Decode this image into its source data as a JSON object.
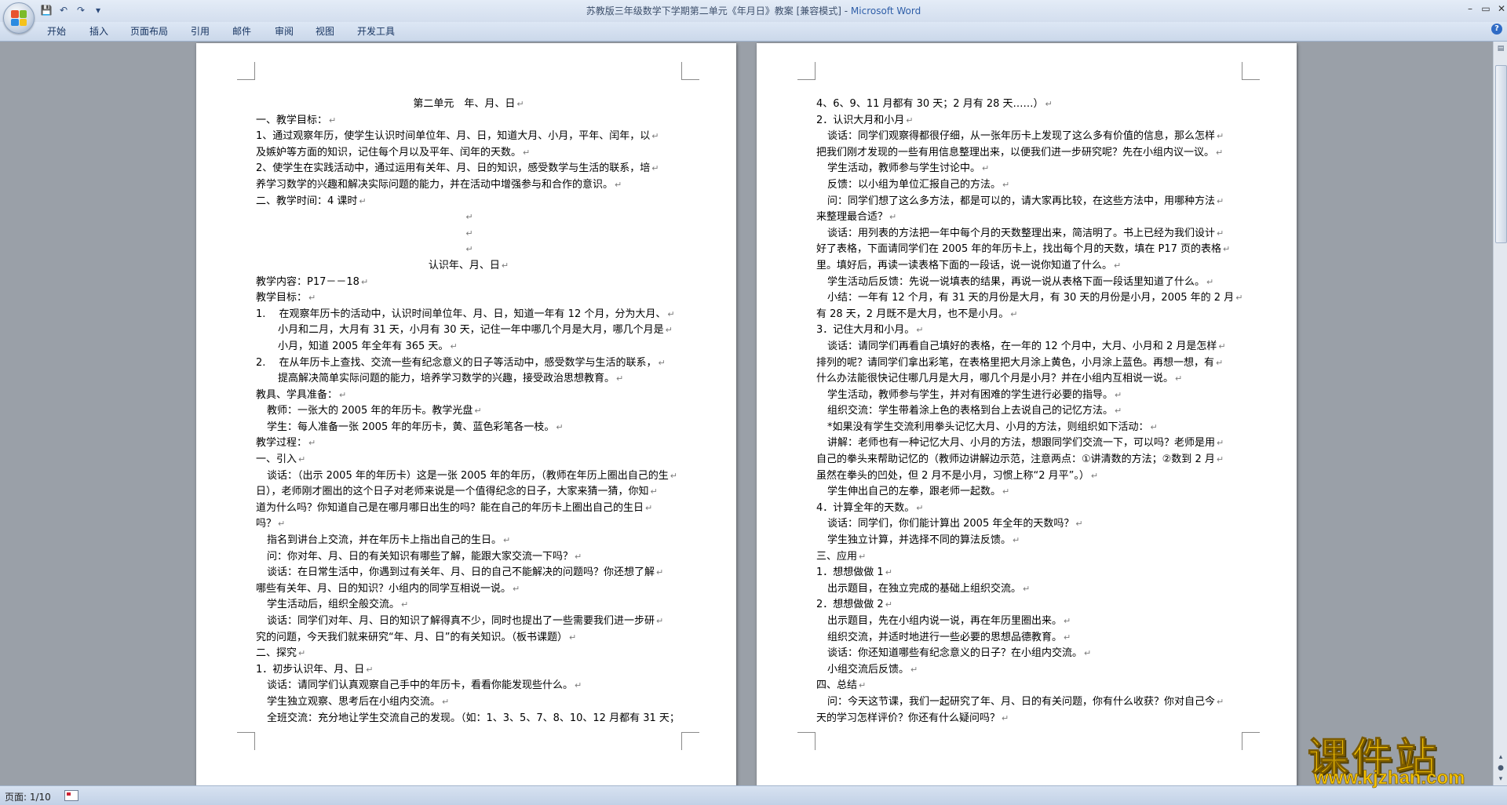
{
  "window": {
    "title": "苏教版三年级数学下学期第二单元《年月日》教案 [兼容模式] - ",
    "app_name": "Microsoft Word",
    "minimize": "–",
    "maximize": "▭",
    "close": "✕"
  },
  "qat": {
    "save": "💾",
    "undo": "↶",
    "redo": "↷",
    "dropdown": "▾"
  },
  "ribbon_tabs": [
    "开始",
    "插入",
    "页面布局",
    "引用",
    "邮件",
    "审阅",
    "视图",
    "开发工具"
  ],
  "help": "?",
  "pages": {
    "left": [
      {
        "t": "第二单元　年、月、日",
        "c": "c"
      },
      {
        "t": "一、教学目标："
      },
      {
        "t": "1、通过观察年历，使学生认识时间单位年、月、日，知道大月、小月，平年、闰年，以"
      },
      {
        "t": "及嫉妒等方面的知识，记住每个月以及平年、闰年的天数。"
      },
      {
        "t": "2、使学生在实践活动中，通过运用有关年、月、日的知识，感受数学与生活的联系，培"
      },
      {
        "t": "养学习数学的兴趣和解决实际问题的能力，并在活动中增强参与和合作的意识。"
      },
      {
        "t": "二、教学时间：4 课时"
      },
      {
        "t": "",
        "c": "c"
      },
      {
        "t": "",
        "c": "c"
      },
      {
        "t": "",
        "c": "c"
      },
      {
        "t": "认识年、月、日",
        "c": "c"
      },
      {
        "t": "教学内容：P17－－18"
      },
      {
        "t": "教学目标："
      },
      {
        "t": "1.　 在观察年历卡的活动中，认识时间单位年、月、日，知道一年有 12 个月，分为大月、"
      },
      {
        "t": "小月和二月，大月有 31 天，小月有 30 天，记住一年中哪几个月是大月，哪几个月是",
        "c": "hang2"
      },
      {
        "t": "小月，知道 2005 年全年有 365 天。",
        "c": "hang2"
      },
      {
        "t": "2.　 在从年历卡上查找、交流一些有纪念意义的日子等活动中，感受数学与生活的联系，"
      },
      {
        "t": "提高解决简单实际问题的能力，培养学习数学的兴趣，接受政治思想教育。",
        "c": "hang2"
      },
      {
        "t": "教具、学具准备："
      },
      {
        "t": "教师：一张大的 2005 年的年历卡。教学光盘",
        "c": "i2"
      },
      {
        "t": "学生：每人准备一张 2005 年的年历卡，黄、蓝色彩笔各一枝。",
        "c": "i2"
      },
      {
        "t": "教学过程："
      },
      {
        "t": "一、引入"
      },
      {
        "t": "谈话：（出示 2005 年的年历卡）这是一张 2005 年的年历，（教师在年历上圈出自己的生",
        "c": "i2"
      },
      {
        "t": "日），老师刚才圈出的这个日子对老师来说是一个值得纪念的日子，大家来猜一猜，你知"
      },
      {
        "t": "道为什么吗？你知道自己是在哪月哪日出生的吗？能在自己的年历卡上圈出自己的生日"
      },
      {
        "t": "吗？"
      },
      {
        "t": "指名到讲台上交流，并在年历卡上指出自己的生日。",
        "c": "i2"
      },
      {
        "t": "问：你对年、月、日的有关知识有哪些了解，能跟大家交流一下吗？",
        "c": "i2"
      },
      {
        "t": "谈话：在日常生活中，你遇到过有关年、月、日的自己不能解决的问题吗？你还想了解",
        "c": "i2"
      },
      {
        "t": "哪些有关年、月、日的知识？小组内的同学互相说一说。"
      },
      {
        "t": "学生活动后，组织全般交流。",
        "c": "i2"
      },
      {
        "t": "谈话：同学们对年、月、日的知识了解得真不少，同时也提出了一些需要我们进一步研",
        "c": "i2"
      },
      {
        "t": "究的问题，今天我们就来研究“年、月、日”的有关知识。（板书课题）"
      },
      {
        "t": "二、探究"
      },
      {
        "t": "1．初步认识年、月、日"
      },
      {
        "t": "谈话：请同学们认真观察自己手中的年历卡，看看你能发现些什么。",
        "c": "i2"
      },
      {
        "t": "学生独立观察、思考后在小组内交流。",
        "c": "i2"
      },
      {
        "t": "全班交流：充分地让学生交流自己的发现。（如：1、3、5、7、8、10、12 月都有 31 天；",
        "c": "i2"
      }
    ],
    "right": [
      {
        "t": "4、6、9、11 月都有 30 天；2 月有 28 天……）"
      },
      {
        "t": "2．认识大月和小月"
      },
      {
        "t": "谈话：同学们观察得都很仔细，从一张年历卡上发现了这么多有价值的信息，那么怎样",
        "c": "i2"
      },
      {
        "t": "把我们刚才发现的一些有用信息整理出来，以便我们进一步研究呢？先在小组内议一议。"
      },
      {
        "t": "学生活动，教师参与学生讨论中。",
        "c": "i2"
      },
      {
        "t": "反馈：以小组为单位汇报自己的方法。",
        "c": "i2"
      },
      {
        "t": "问：同学们想了这么多方法，都是可以的，请大家再比较，在这些方法中，用哪种方法",
        "c": "i2"
      },
      {
        "t": "来整理最合适？"
      },
      {
        "t": "谈话：用列表的方法把一年中每个月的天数整理出来，简洁明了。书上已经为我们设计",
        "c": "i2"
      },
      {
        "t": "好了表格，下面请同学们在 2005 年的年历卡上，找出每个月的天数，填在 P17 页的表格"
      },
      {
        "t": "里。填好后，再读一读表格下面的一段话，说一说你知道了什么。"
      },
      {
        "t": "学生活动后反馈：先说一说填表的结果，再说一说从表格下面一段话里知道了什么。",
        "c": "i2"
      },
      {
        "t": "小结：一年有 12 个月，有 31 天的月份是大月，有 30 天的月份是小月，2005 年的 2 月",
        "c": "i2"
      },
      {
        "t": "有 28 天，2 月既不是大月，也不是小月。"
      },
      {
        "t": "3．记住大月和小月。"
      },
      {
        "t": "谈话：请同学们再看自己填好的表格，在一年的 12 个月中，大月、小月和 2 月是怎样",
        "c": "i2"
      },
      {
        "t": "排列的呢？请同学们拿出彩笔，在表格里把大月涂上黄色，小月涂上蓝色。再想一想，有"
      },
      {
        "t": "什么办法能很快记住哪几月是大月，哪几个月是小月？并在小组内互相说一说。"
      },
      {
        "t": "学生活动，教师参与学生，并对有困难的学生进行必要的指导。",
        "c": "i2"
      },
      {
        "t": "组织交流：学生带着涂上色的表格到台上去说自己的记忆方法。",
        "c": "i2"
      },
      {
        "t": "*如果没有学生交流利用拳头记忆大月、小月的方法，则组织如下活动：",
        "c": "i2"
      },
      {
        "t": "讲解：老师也有一种记忆大月、小月的方法，想跟同学们交流一下，可以吗？老师是用",
        "c": "i2"
      },
      {
        "t": "自己的拳头来帮助记忆的（教师边讲解边示范，注意两点：①讲清数的方法；②数到 2 月"
      },
      {
        "t": "虽然在拳头的凹处，但 2 月不是小月，习惯上称“2 月平”。）"
      },
      {
        "t": "学生伸出自己的左拳，跟老师一起数。",
        "c": "i2"
      },
      {
        "t": "4．计算全年的天数。"
      },
      {
        "t": "谈话：同学们，你们能计算出 2005 年全年的天数吗？",
        "c": "i2"
      },
      {
        "t": "学生独立计算，并选择不同的算法反馈。",
        "c": "i2"
      },
      {
        "t": "三、应用"
      },
      {
        "t": "1．想想做做 1"
      },
      {
        "t": "出示题目，在独立完成的基础上组织交流。",
        "c": "i2"
      },
      {
        "t": "2．想想做做 2"
      },
      {
        "t": "出示题目，先在小组内说一说，再在年历里圈出来。",
        "c": "i2"
      },
      {
        "t": "组织交流，并适时地进行一些必要的思想品德教育。",
        "c": "i2"
      },
      {
        "t": "谈话：你还知道哪些有纪念意义的日子？在小组内交流。",
        "c": "i2"
      },
      {
        "t": "小组交流后反馈。",
        "c": "i2"
      },
      {
        "t": "四、总结"
      },
      {
        "t": "问：今天这节课，我们一起研究了年、月、日的有关问题，你有什么收获？你对自己今",
        "c": "i2"
      },
      {
        "t": "天的学习怎样评价？你还有什么疑问吗？"
      }
    ]
  },
  "paragraph_mark": "↵",
  "status": {
    "page": "页面: 1/10"
  },
  "watermark": {
    "main": "课件站",
    "url": "www.kjzhan.com"
  }
}
